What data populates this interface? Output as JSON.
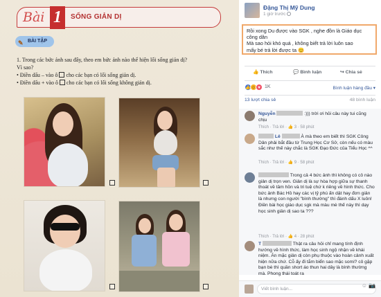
{
  "book": {
    "lesson_word": "Bài",
    "lesson_number": "1",
    "lesson_title": "SỐNG GIẢN DỊ",
    "exercise_tag": "BÀI TẬP",
    "question_lines": [
      "1. Trong các bức ảnh sau đây, theo em bức ảnh nào thể hiện lối sống giản dị?",
      "   Vì sao?",
      "   • Điền dấu – vào ô",
      "   • Điền dấu + vào ô"
    ],
    "option_suffixes": [
      "cho các bạn có lối sống giản dị.",
      "cho các bạn có lối sống không giản dị."
    ]
  },
  "post": {
    "author": "Đặng Thị Mỹ Dung",
    "timestamp": "1 giờ trước",
    "body_lines": [
      "Rồi xong Du được vào SGK , nghe đồn là Giáo dục",
      "công dân",
      "Mà sao hỏi khó quá , không biết trả lời luôn sao",
      "mấy bé trả lời được ta 😊"
    ],
    "actions": {
      "like": "Thích",
      "comment": "Bình luận",
      "share": "Chia sẻ"
    },
    "reactions_count": "1K",
    "sort_label": "Bình luận hàng đầu ▾",
    "shares": "13 lượt chia sẻ",
    "comment_count": "48 bình luận"
  },
  "comments": [
    {
      "name": "Nguyễn",
      "text": ":))) trời ơi hỏi câu này tui cũng chịu",
      "meta": "Thích · Trả lời · 👍 3 · 58 phút",
      "avatar_color": "#8b7a6e"
    },
    {
      "name": "Lê",
      "text": "À mà theo em biết thì SGK Công Dân phải bắt đầu từ Trung Học Cơ Sở, còn nếu có màu sắc như thế này chắc là SGK Đạo Đức của Tiểu Học ^^",
      "meta": "Thích · Trả lời · 👍 9 · 58 phút",
      "avatar_color": "#c9a98a"
    },
    {
      "name": "",
      "text": "Trong cả 4 bức ảnh thì không có cô nào giản dị trọn ven. Giản dị là sự hòa hợp giữa sự thanh thoát về tâm hồn và tri tuệ chứ k riêng về hình thức. Cho bức ảnh Bác Hồ hay các vị tỷ phú ấn dật hay đơn giản là nhưng con người \"bình thường\" thì đánh dấu X luôn! Điền bài học giáo dục sgk mà màu mè thế này thì dạy học sinh giản dị sao ta ???",
      "meta": "Thích · Trả lời · 👍 4 · 28 phút",
      "avatar_color": "#6e7f96"
    },
    {
      "name": "T",
      "text": "Thật ra câu hỏi chỉ mang tính định hướng về hình thức, làm học sinh ngộ nhận về khái niệm. Ăn mặc giản dị còn phụ thuộc vào hoàn cảnh xuất hiện nữa chứ. Cỗ ấy đi tắm biển sao mặc somi? cô gặp bạn bè thì quần short áo thun hai dây là bình thường mà. Phong thái toát ra",
      "meta": "",
      "avatar_color": "#a48d7c"
    }
  ],
  "reply": {
    "placeholder": "Viết bình luận..."
  },
  "colors": {
    "link": "#365899",
    "highlight_border": "#f0a86a",
    "lesson_red": "#c62f2f"
  }
}
